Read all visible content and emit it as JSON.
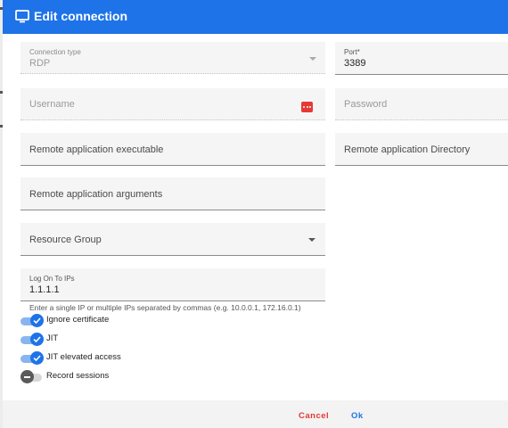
{
  "dialog": {
    "title": "Edit connection",
    "icon": "monitor-icon",
    "accent_color": "#1e73e8"
  },
  "fields": {
    "connection_type": {
      "label": "Connection type",
      "value": "RDP",
      "disabled": true
    },
    "port": {
      "label": "Port*",
      "value": "3389"
    },
    "username": {
      "placeholder": "Username",
      "disabled": true
    },
    "password": {
      "placeholder": "Password",
      "disabled": true,
      "icon": "password-dots-icon"
    },
    "remote_app_executable": {
      "placeholder": "Remote application executable"
    },
    "remote_app_directory": {
      "placeholder": "Remote application Directory"
    },
    "remote_app_arguments": {
      "placeholder": "Remote application arguments"
    },
    "resource_group": {
      "placeholder": "Resource Group"
    },
    "log_on_to_ips": {
      "label": "Log On To IPs",
      "value": "1.1.1.1",
      "hint": "Enter a single IP or multiple IPs separated by commas (e.g. 10.0.0.1, 172.16.0.1)"
    }
  },
  "toggles": [
    {
      "label": "Ignore certificate",
      "checked": true
    },
    {
      "label": "JIT",
      "checked": true
    },
    {
      "label": "JIT elevated access",
      "checked": true
    },
    {
      "label": "Record sessions",
      "checked": false
    }
  ],
  "footer": {
    "cancel_label": "Cancel",
    "ok_label": "Ok",
    "cancel_color": "#e53935",
    "ok_color": "#1e73e8"
  }
}
